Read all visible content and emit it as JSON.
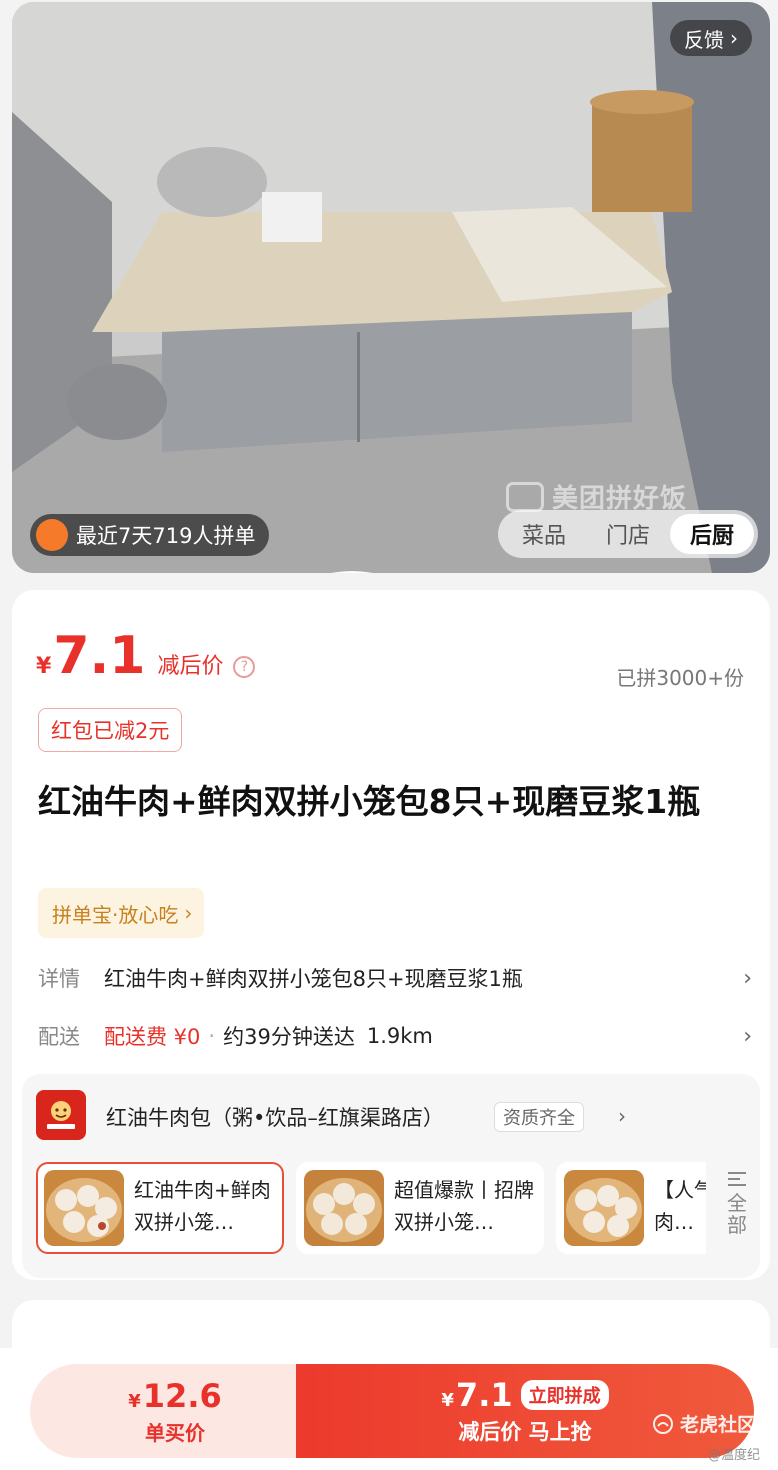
{
  "hero": {
    "feedback_label": "反馈",
    "recent_text": "最近7天719人拼单",
    "watermark_text": "美团拼好饭",
    "tabs": [
      {
        "label": "菜品",
        "active": false
      },
      {
        "label": "门店",
        "active": false
      },
      {
        "label": "后厨",
        "active": true
      }
    ]
  },
  "product": {
    "currency": "¥",
    "price": "7.1",
    "price_label": "减后价",
    "sold_text": "已拼3000+份",
    "coupon_text": "红包已减2元",
    "title": "红油牛肉+鲜肉双拼小笼包8只+现磨豆浆1瓶",
    "badge_text": "拼单宝·放心吃",
    "details_key": "详情",
    "details_value": "红油牛肉+鲜肉双拼小笼包8只+现磨豆浆1瓶",
    "delivery_key": "配送",
    "delivery_fee": "配送费 ¥0",
    "delivery_time": "约39分钟送达",
    "delivery_distance": "1.9km"
  },
  "shop": {
    "name": "红油牛肉包（粥•饮品–红旗渠路店）",
    "qualification": "资质齐全",
    "all_label_1": "全",
    "all_label_2": "部",
    "dishes": [
      {
        "name": "红油牛肉+鲜肉双拼小笼…",
        "active": true
      },
      {
        "name": "超值爆款丨招牌双拼小笼…",
        "active": false
      },
      {
        "name": "【人气】红油牛肉…",
        "active": false
      }
    ]
  },
  "bottom_bar": {
    "single_currency": "¥",
    "single_price": "12.6",
    "single_label": "单买价",
    "group_currency": "¥",
    "group_price": "7.1",
    "group_tag": "立即拼成",
    "group_label": "减后价 马上抢"
  },
  "overlay": {
    "community_name": "老虎社区",
    "user_handle": "@温度纪"
  },
  "colors": {
    "accent_red": "#e8312a",
    "badge_gold": "#c7811d",
    "avatar_orange": "#f57b2a"
  }
}
